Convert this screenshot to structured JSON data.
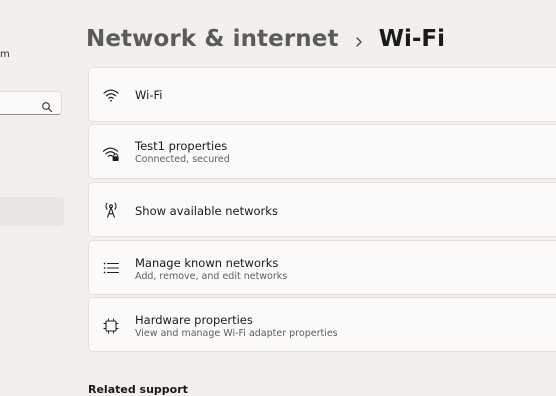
{
  "sidebar": {
    "user_name_fragment": "m"
  },
  "breadcrumb": {
    "parent": "Network & internet",
    "current": "Wi-Fi"
  },
  "cards": [
    {
      "id": "wifi",
      "icon": "wifi-icon",
      "title": "Wi-Fi"
    },
    {
      "id": "properties",
      "icon": "wifi-lock-icon",
      "title": "Test1 properties",
      "subtitle": "Connected, secured"
    },
    {
      "id": "available",
      "icon": "antenna-icon",
      "title": "Show available networks"
    },
    {
      "id": "known",
      "icon": "list-icon",
      "title": "Manage known networks",
      "subtitle": "Add, remove, and edit networks"
    },
    {
      "id": "hardware",
      "icon": "chip-icon",
      "title": "Hardware properties",
      "subtitle": "View and manage Wi-Fi adapter properties"
    }
  ],
  "related_support": {
    "heading": "Related support"
  }
}
